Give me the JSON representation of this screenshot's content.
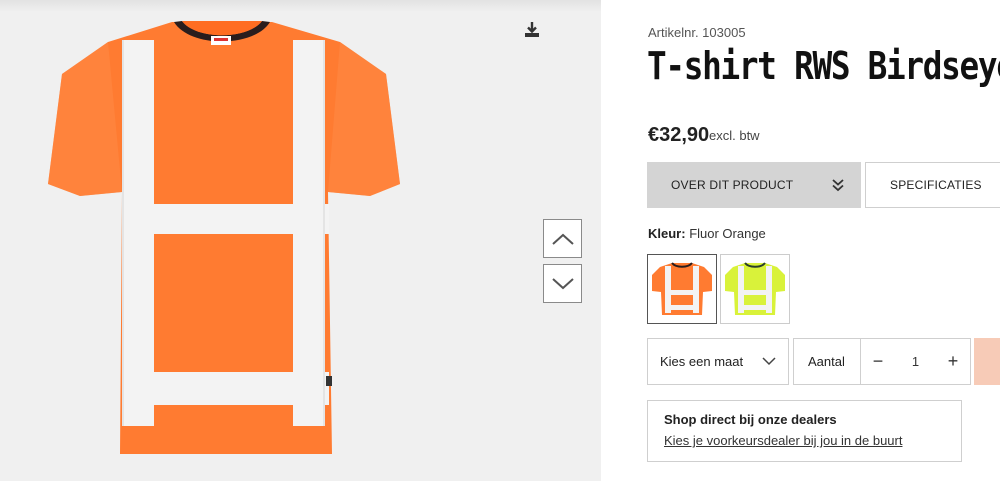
{
  "product": {
    "article_label": "Artikelnr. 103005",
    "title": "T-shirt RWS Birdseye",
    "price": "€32,90",
    "price_note": "excl. btw"
  },
  "tabs": [
    {
      "label": "OVER DIT PRODUCT"
    },
    {
      "label": "SPECIFICATIES"
    }
  ],
  "color": {
    "label": "Kleur:",
    "value": "Fluor Orange",
    "swatches": [
      {
        "name": "Fluor Orange",
        "hex": "#ff7b31",
        "selected": true
      },
      {
        "name": "Fluor Yellow",
        "hex": "#d9f23a",
        "selected": false
      }
    ]
  },
  "size_select": {
    "label": "Kies een maat"
  },
  "quantity": {
    "label": "Aantal",
    "value": "1",
    "minus": "−",
    "plus": "+"
  },
  "dealer": {
    "title": "Shop direct bij onze dealers",
    "link": "Kies je voorkeursdealer bij jou in de buurt"
  },
  "colors": {
    "shirt": "#ff7b31",
    "reflective": "#f3f3f3",
    "collar": "#2a1d1d",
    "tab_active_bg": "#d4d4d4",
    "cart_button": "#f7cbb7"
  },
  "icons": {
    "download": "download-icon",
    "up": "chevron-up-icon",
    "down": "chevron-down-icon"
  }
}
